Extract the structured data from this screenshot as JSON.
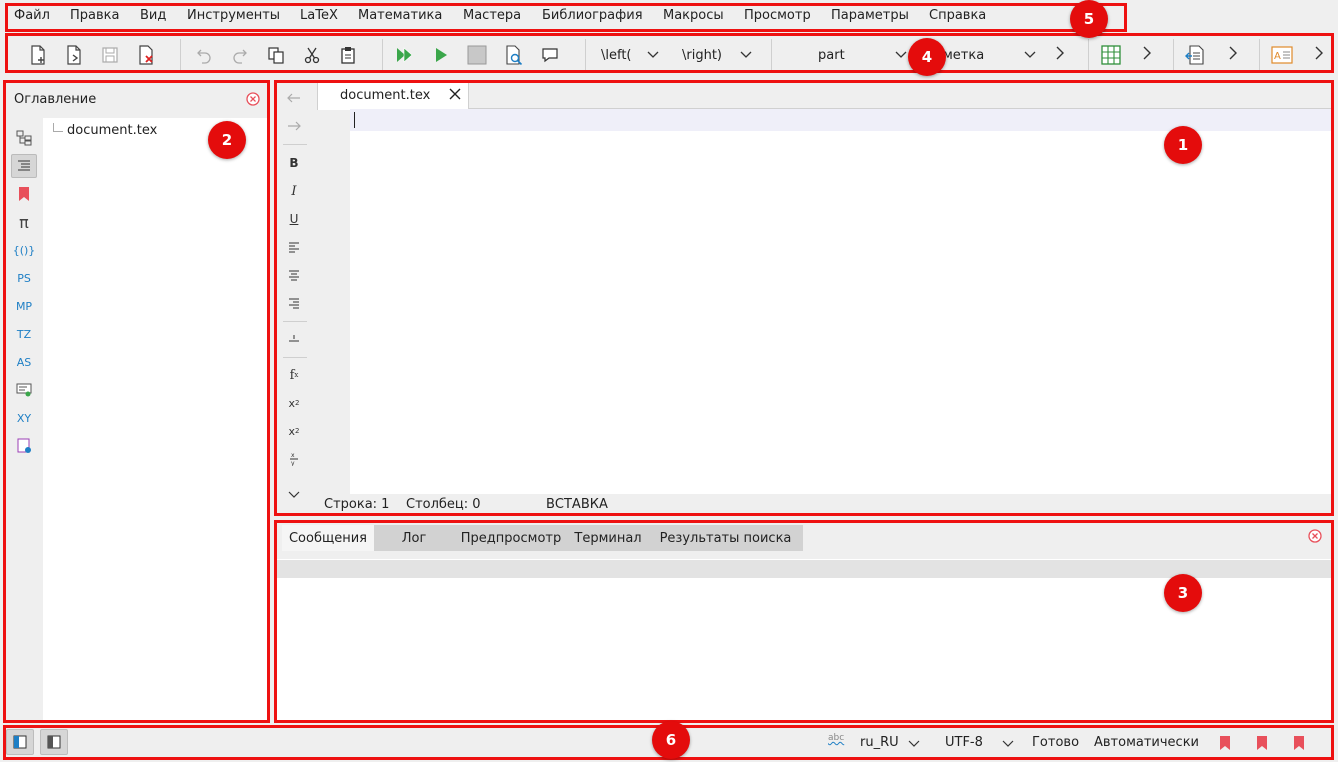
{
  "menu": {
    "items": [
      "Файл",
      "Правка",
      "Вид",
      "Инструменты",
      "LaTeX",
      "Математика",
      "Мастера",
      "Библиография",
      "Макросы",
      "Просмотр",
      "Параметры",
      "Справка"
    ]
  },
  "toolbar": {
    "left_delim": "\\left(",
    "right_delim": "\\right)",
    "structure_combo": "part",
    "label_combo": "метка"
  },
  "toc": {
    "title": "Оглавление",
    "side_labels": [
      "PS",
      "MP",
      "TZ",
      "AS",
      "XY"
    ],
    "tree_item": "document.tex"
  },
  "editor": {
    "tab_label": "document.tex",
    "side_buttons": {
      "bold": "B",
      "italic": "I",
      "underline": "U"
    }
  },
  "status_line": {
    "row": "Строка: 1",
    "col": "Столбец: 0",
    "mode": "ВСТАВКА"
  },
  "messages": {
    "tabs": [
      "Сообщения",
      "Лог",
      "Предпросмотр",
      "Терминал",
      "Результаты поиска"
    ],
    "active_tab": "Сообщения"
  },
  "statusbar": {
    "spell_icon_text": "abc",
    "language": "ru_RU",
    "encoding": "UTF-8",
    "state": "Готово",
    "mode": "Автоматически"
  },
  "annotations": [
    "1",
    "2",
    "3",
    "4",
    "5",
    "6"
  ],
  "colors": {
    "annotation_red": "#e40c0c",
    "bookmark_red": "#e8505b",
    "accent_blue": "#1e7fc5",
    "run_green": "#3aa64a"
  }
}
